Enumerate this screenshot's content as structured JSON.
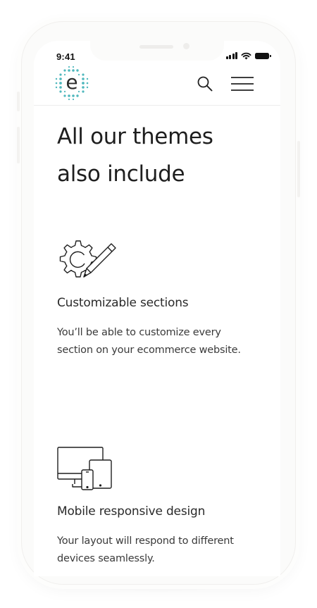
{
  "status_bar": {
    "time": "9:41"
  },
  "header": {
    "logo_letter": "e",
    "logo_icon": "e-logo-dotted",
    "search_icon": "search-icon",
    "menu_icon": "hamburger-menu-icon"
  },
  "main": {
    "title_line1": "All our themes",
    "title_line2": "also include",
    "features": [
      {
        "icon": "gear-pencil-icon",
        "title": "Customizable sections",
        "desc_line1": "You’ll be able to customize every",
        "desc_line2": "section on your ecommerce website."
      },
      {
        "icon": "devices-icon",
        "title": "Mobile responsive design",
        "desc_line1": "Your layout will respond to different",
        "desc_line2": "devices seamlessly."
      }
    ]
  },
  "colors": {
    "logo_accent": "#4fb8bd",
    "text": "#1e1e1e"
  }
}
